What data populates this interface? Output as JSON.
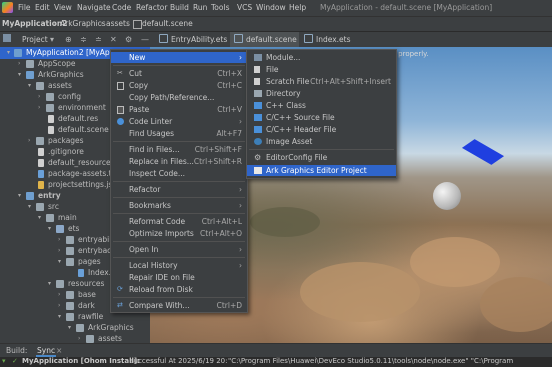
{
  "menubar": {
    "items": [
      "File",
      "Edit",
      "View",
      "Navigate",
      "Code",
      "Refactor",
      "Build",
      "Run",
      "Tools",
      "VCS",
      "Window",
      "Help"
    ],
    "window_title": "MyApplication - default.scene [MyApplication]"
  },
  "navbar": {
    "crumbs": [
      "MyApplication2",
      "ArkGraphics",
      "assets",
      "default.scene"
    ]
  },
  "toolbar": {
    "project_label": "Project",
    "tabs": [
      {
        "label": "EntryAbility.ets",
        "active": false
      },
      {
        "label": "default.scene",
        "active": true
      },
      {
        "label": "Index.ets",
        "active": false
      }
    ]
  },
  "tree": {
    "root": "MyApplication2 [MyApplication]",
    "items": [
      {
        "label": "AppScope"
      },
      {
        "label": "ArkGraphics"
      },
      {
        "label": "assets"
      },
      {
        "label": "config"
      },
      {
        "label": "environment"
      },
      {
        "label": "default.res"
      },
      {
        "label": "default.scene"
      },
      {
        "label": "packages"
      },
      {
        "label": ".gitignore"
      },
      {
        "label": "default_resources.res"
      },
      {
        "label": "package-assets.ts"
      },
      {
        "label": "projectsettings.json"
      },
      {
        "label": "entry"
      },
      {
        "label": "src"
      },
      {
        "label": "main"
      },
      {
        "label": "ets"
      },
      {
        "label": "entryability"
      },
      {
        "label": "entrybackup"
      },
      {
        "label": "pages"
      },
      {
        "label": "Index.ets"
      },
      {
        "label": "resources"
      },
      {
        "label": "base"
      },
      {
        "label": "dark"
      },
      {
        "label": "rawfile"
      },
      {
        "label": "ArkGraphics"
      },
      {
        "label": "assets"
      }
    ]
  },
  "scene": {
    "warning": "rk properly."
  },
  "context_menu": {
    "items": [
      {
        "label": "New",
        "shortcut": "",
        "arrow": true,
        "highlight": true
      },
      {
        "label": "Cut",
        "shortcut": "Ctrl+X"
      },
      {
        "label": "Copy",
        "shortcut": "Ctrl+C"
      },
      {
        "label": "Copy Path/Reference...",
        "shortcut": ""
      },
      {
        "label": "Paste",
        "shortcut": "Ctrl+V"
      },
      {
        "label": "Code Linter",
        "shortcut": "",
        "arrow": true
      },
      {
        "label": "Find Usages",
        "shortcut": "Alt+F7"
      },
      {
        "label": "Find in Files...",
        "shortcut": "Ctrl+Shift+F"
      },
      {
        "label": "Replace in Files...",
        "shortcut": "Ctrl+Shift+R"
      },
      {
        "label": "Inspect Code...",
        "shortcut": ""
      },
      {
        "label": "Refactor",
        "shortcut": "",
        "arrow": true
      },
      {
        "label": "Bookmarks",
        "shortcut": "",
        "arrow": true
      },
      {
        "label": "Reformat Code",
        "shortcut": "Ctrl+Alt+L"
      },
      {
        "label": "Optimize Imports",
        "shortcut": "Ctrl+Alt+O"
      },
      {
        "label": "Open In",
        "shortcut": "",
        "arrow": true
      },
      {
        "label": "Local History",
        "shortcut": "",
        "arrow": true
      },
      {
        "label": "Repair IDE on File",
        "shortcut": ""
      },
      {
        "label": "Reload from Disk",
        "shortcut": ""
      },
      {
        "label": "Compare With...",
        "shortcut": "Ctrl+D"
      }
    ]
  },
  "submenu": {
    "items": [
      {
        "label": "Module...",
        "shortcut": ""
      },
      {
        "label": "File",
        "shortcut": ""
      },
      {
        "label": "Scratch File",
        "shortcut": "Ctrl+Alt+Shift+Insert"
      },
      {
        "label": "Directory",
        "shortcut": ""
      },
      {
        "label": "C++ Class",
        "shortcut": ""
      },
      {
        "label": "C/C++ Source File",
        "shortcut": ""
      },
      {
        "label": "C/C++ Header File",
        "shortcut": ""
      },
      {
        "label": "Image Asset",
        "shortcut": ""
      },
      {
        "label": "EditorConfig File",
        "shortcut": ""
      },
      {
        "label": "Ark Graphics Editor Project",
        "shortcut": "",
        "highlight": true
      }
    ]
  },
  "bottom": {
    "build_tab": "Build:",
    "sync_tab": "Sync",
    "status_prefix": "MyApplication [Ohom Install]:",
    "status_text": "successful At 2025/6/19 20:",
    "status_cmd": "\"C:\\Program Files\\Huawei\\DevEco Studio5.0.11\\tools\\node\\node.exe\" \"C:\\Program"
  },
  "colors": {
    "selection": "#2f65ca",
    "panel": "#3c3f41",
    "plane": "#1f3fe0"
  }
}
